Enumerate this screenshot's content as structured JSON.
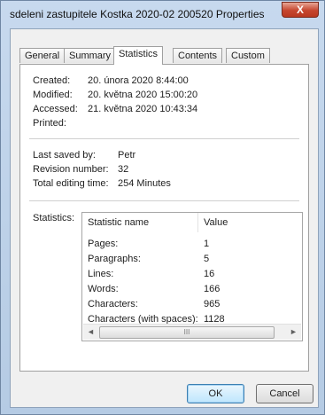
{
  "window": {
    "title": "sdeleni zastupitele Kostka 2020-02 200520 Properties",
    "close_label": "X"
  },
  "tabs": [
    {
      "label": "General"
    },
    {
      "label": "Summary"
    },
    {
      "label": "Statistics",
      "active": true
    },
    {
      "label": "Contents"
    },
    {
      "label": "Custom"
    }
  ],
  "dates": {
    "created_label": "Created:",
    "created_value": "20. února 2020 8:44:00",
    "modified_label": "Modified:",
    "modified_value": "20. května 2020 15:00:20",
    "accessed_label": "Accessed:",
    "accessed_value": "21. května 2020 10:43:34",
    "printed_label": "Printed:",
    "printed_value": ""
  },
  "save_info": {
    "last_saved_label": "Last saved by:",
    "last_saved_value": "Petr",
    "revision_label": "Revision number:",
    "revision_value": "32",
    "editing_label": "Total editing time:",
    "editing_value": "254 Minutes"
  },
  "statistics": {
    "label": "Statistics:",
    "col_name": "Statistic name",
    "col_value": "Value",
    "rows": [
      {
        "name": "Pages:",
        "value": "1"
      },
      {
        "name": "Paragraphs:",
        "value": "5"
      },
      {
        "name": "Lines:",
        "value": "16"
      },
      {
        "name": "Words:",
        "value": "166"
      },
      {
        "name": "Characters:",
        "value": "965"
      },
      {
        "name": "Characters (with spaces):",
        "value": "1128"
      }
    ],
    "scroll_left": "◄",
    "scroll_grip": "III",
    "scroll_right": "►"
  },
  "buttons": {
    "ok": "OK",
    "cancel": "Cancel"
  }
}
